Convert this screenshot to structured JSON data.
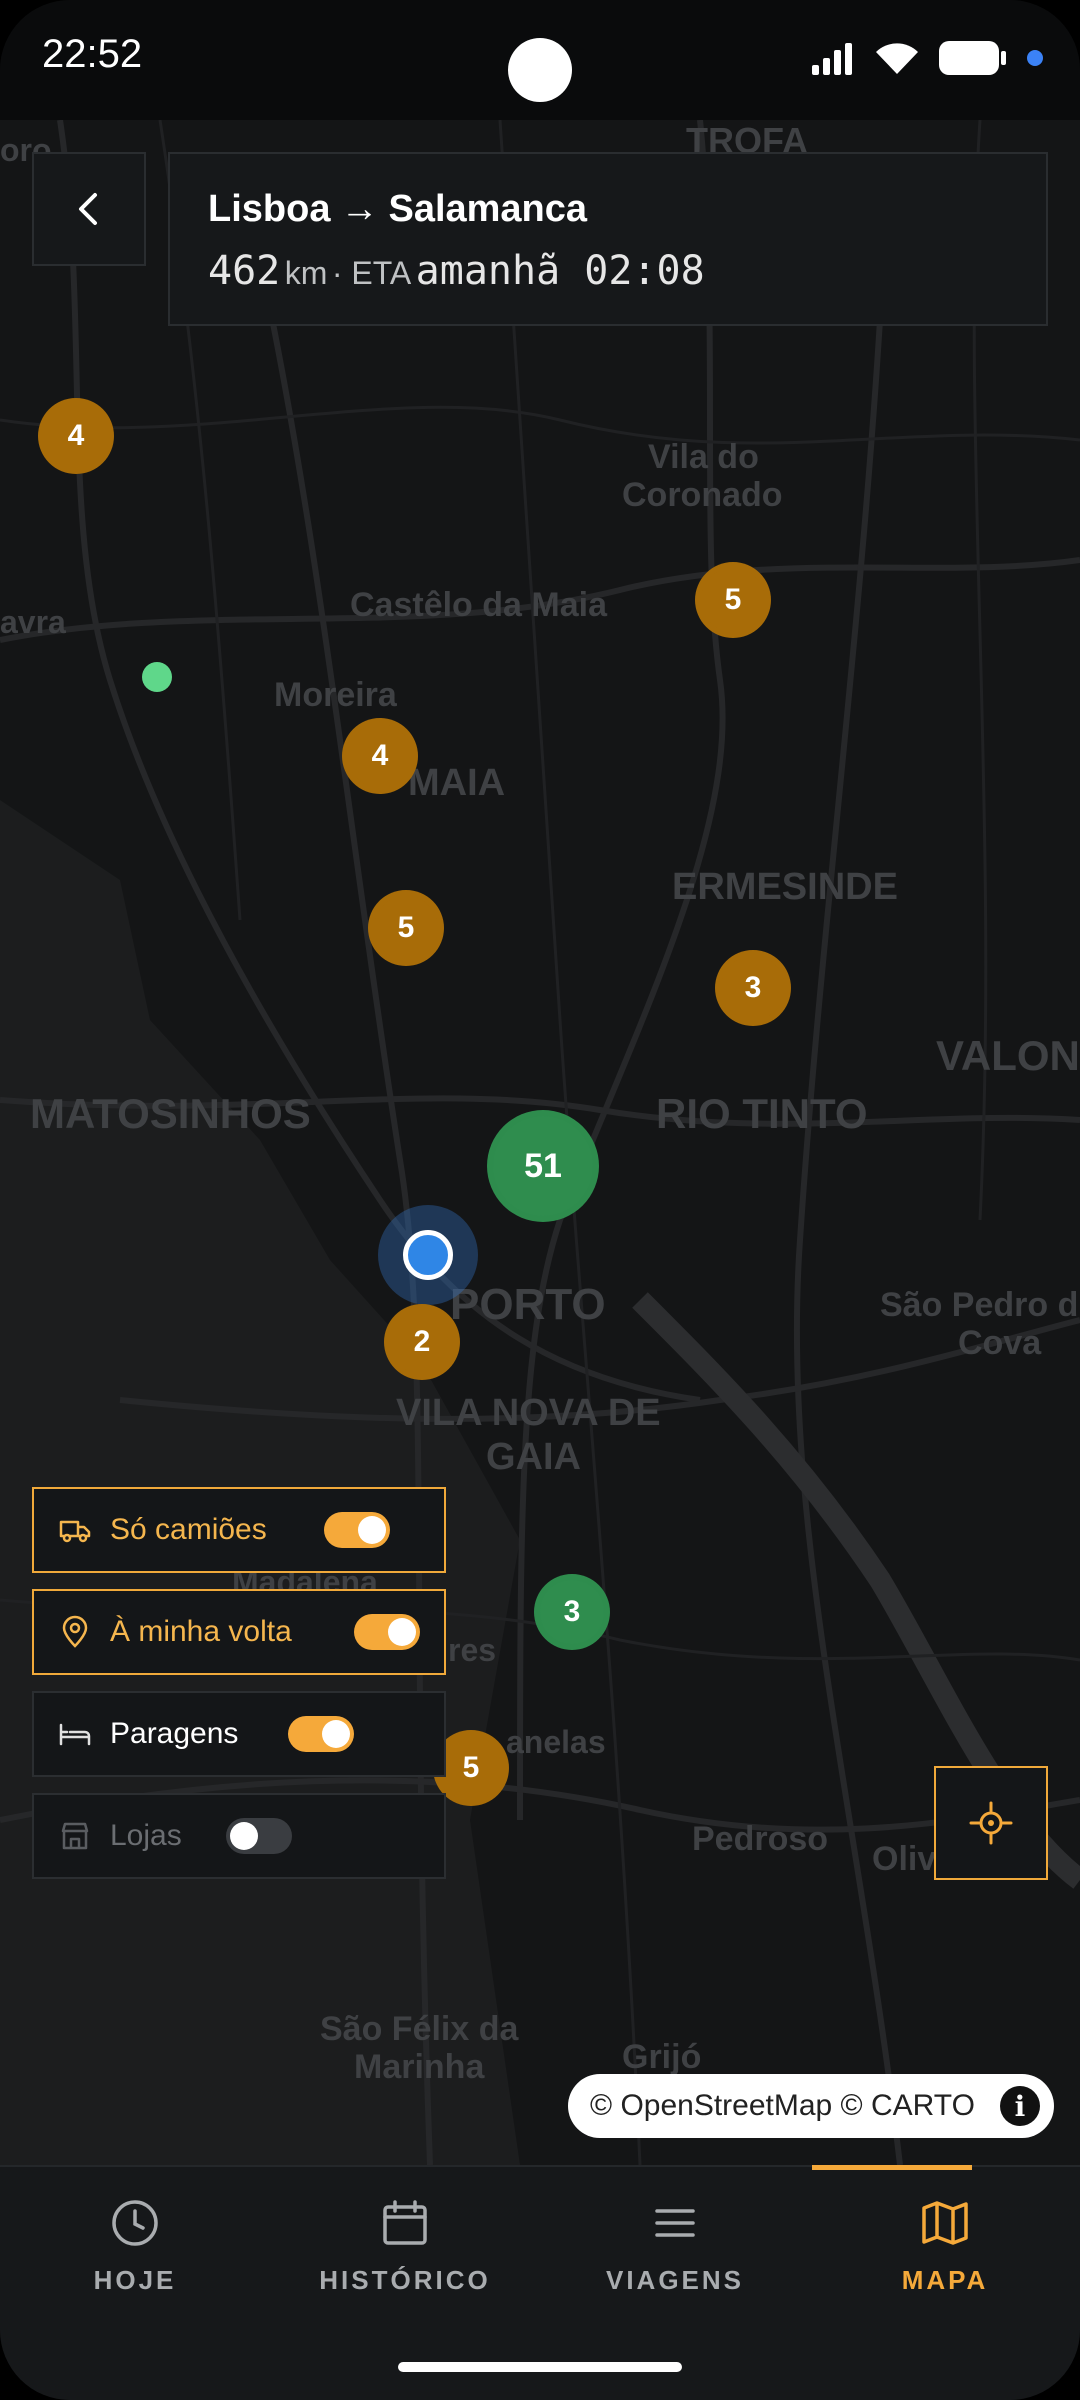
{
  "status_bar": {
    "time": "22:52"
  },
  "header": {
    "origin": "Lisboa",
    "arrow": "→",
    "destination": "Salamanca",
    "distance_value": "462",
    "distance_unit": "km",
    "eta_prefix": "· ETA",
    "eta_value": "amanhã 02:08"
  },
  "map": {
    "place_labels": [
      "TROFA",
      "Vila do",
      "Coronado",
      "Castêlo da Maia",
      "Moreira",
      "MAIA",
      "ERMESINDE",
      "MATOSINHOS",
      "RIO TINTO",
      "VALON",
      "PORTO",
      "São Pedro d",
      "Cova",
      "VILA NOVA DE",
      "GAIA",
      "Madalena",
      "res",
      "anelas",
      "Pedroso",
      "Oliv",
      "São Félix da",
      "Marinha",
      "Grijó",
      "avra",
      "oro"
    ],
    "clusters": [
      "4",
      "5",
      "4",
      "5",
      "3",
      "51",
      "2",
      "3",
      "5"
    ],
    "attribution": "© OpenStreetMap © CARTO",
    "info_symbol": "i"
  },
  "filters": [
    {
      "label": "Só camiões",
      "icon": "truck-icon",
      "enabled": true
    },
    {
      "label": "À minha volta",
      "icon": "location-pin-icon",
      "enabled": true
    },
    {
      "label": "Paragens",
      "icon": "bed-icon",
      "enabled": true
    },
    {
      "label": "Lojas",
      "icon": "store-icon",
      "enabled": false
    }
  ],
  "nav": {
    "tabs": [
      {
        "label": "HOJE",
        "icon": "clock-icon"
      },
      {
        "label": "HISTÓRICO",
        "icon": "calendar-icon"
      },
      {
        "label": "VIAGENS",
        "icon": "list-icon"
      },
      {
        "label": "MAPA",
        "icon": "map-icon"
      }
    ],
    "active": "MAPA"
  },
  "colors": {
    "accent": "#f5a93a",
    "cluster_amber": "#a86c08",
    "cluster_green": "#2f8d4e",
    "location_blue": "#2f86e6"
  }
}
